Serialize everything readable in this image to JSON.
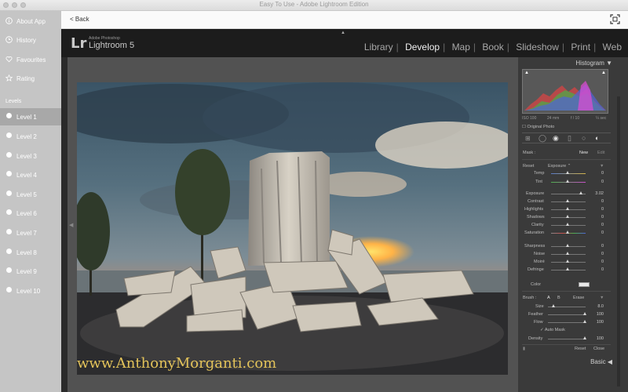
{
  "window": {
    "title": "Easy To Use - Adobe Lightroom Edition"
  },
  "sidebar": {
    "top_items": [
      {
        "label": "About App",
        "icon": "info-icon"
      },
      {
        "label": "History",
        "icon": "clock-icon"
      },
      {
        "label": "Favourites",
        "icon": "heart-icon"
      },
      {
        "label": "Rating",
        "icon": "star-icon"
      }
    ],
    "section_label": "Levels",
    "levels": [
      {
        "label": "Level 1"
      },
      {
        "label": "Level 2"
      },
      {
        "label": "Level 3"
      },
      {
        "label": "Level 4"
      },
      {
        "label": "Level 5"
      },
      {
        "label": "Level 6"
      },
      {
        "label": "Level 7"
      },
      {
        "label": "Level 8"
      },
      {
        "label": "Level 9"
      },
      {
        "label": "Level 10"
      }
    ],
    "active_level": "Level 1"
  },
  "nav": {
    "back_label": "< Back"
  },
  "lightroom": {
    "logo": "Lr",
    "subtitle_small": "Adobe Photoshop",
    "subtitle": "Lightroom 5",
    "modules": [
      "Library",
      "Develop",
      "Map",
      "Book",
      "Slideshow",
      "Print",
      "Web"
    ],
    "active_module": "Develop",
    "watermark": "www.AnthonyMorganti.com"
  },
  "panel": {
    "histogram_title": "Histogram",
    "meta": {
      "iso": "ISO 100",
      "focal": "24 mm",
      "aperture": "f / 10",
      "shutter": "¼ sec"
    },
    "original_photo_label": "Original Photo",
    "mask_label": "Mask :",
    "mask_new": "New",
    "mask_edit": "Edit",
    "effect_reset": "Reset",
    "effect_name": "Exposure",
    "temp": {
      "label": "Temp",
      "value": "0"
    },
    "tint": {
      "label": "Tint",
      "value": "0"
    },
    "adjustments": [
      {
        "label": "Exposure",
        "value": "3.02"
      },
      {
        "label": "Contrast",
        "value": "0"
      },
      {
        "label": "Highlights",
        "value": "0"
      },
      {
        "label": "Shadows",
        "value": "0"
      },
      {
        "label": "Clarity",
        "value": "0"
      },
      {
        "label": "Saturation",
        "value": "0"
      }
    ],
    "detail": [
      {
        "label": "Sharpness",
        "value": "0"
      },
      {
        "label": "Noise",
        "value": "0"
      },
      {
        "label": "Moiré",
        "value": "0"
      },
      {
        "label": "Defringe",
        "value": "0"
      }
    ],
    "color_label": "Color",
    "brush": {
      "label": "Brush :",
      "a": "A",
      "b": "B",
      "erase": "Erase",
      "size": {
        "label": "Size",
        "value": "8.0"
      },
      "feather": {
        "label": "Feather",
        "value": "100"
      },
      "flow": {
        "label": "Flow",
        "value": "100"
      },
      "auto_mask": "Auto Mask",
      "density": {
        "label": "Density",
        "value": "100"
      }
    },
    "reset_label": "Reset",
    "close_label": "Close",
    "basic_label": "Basic"
  }
}
